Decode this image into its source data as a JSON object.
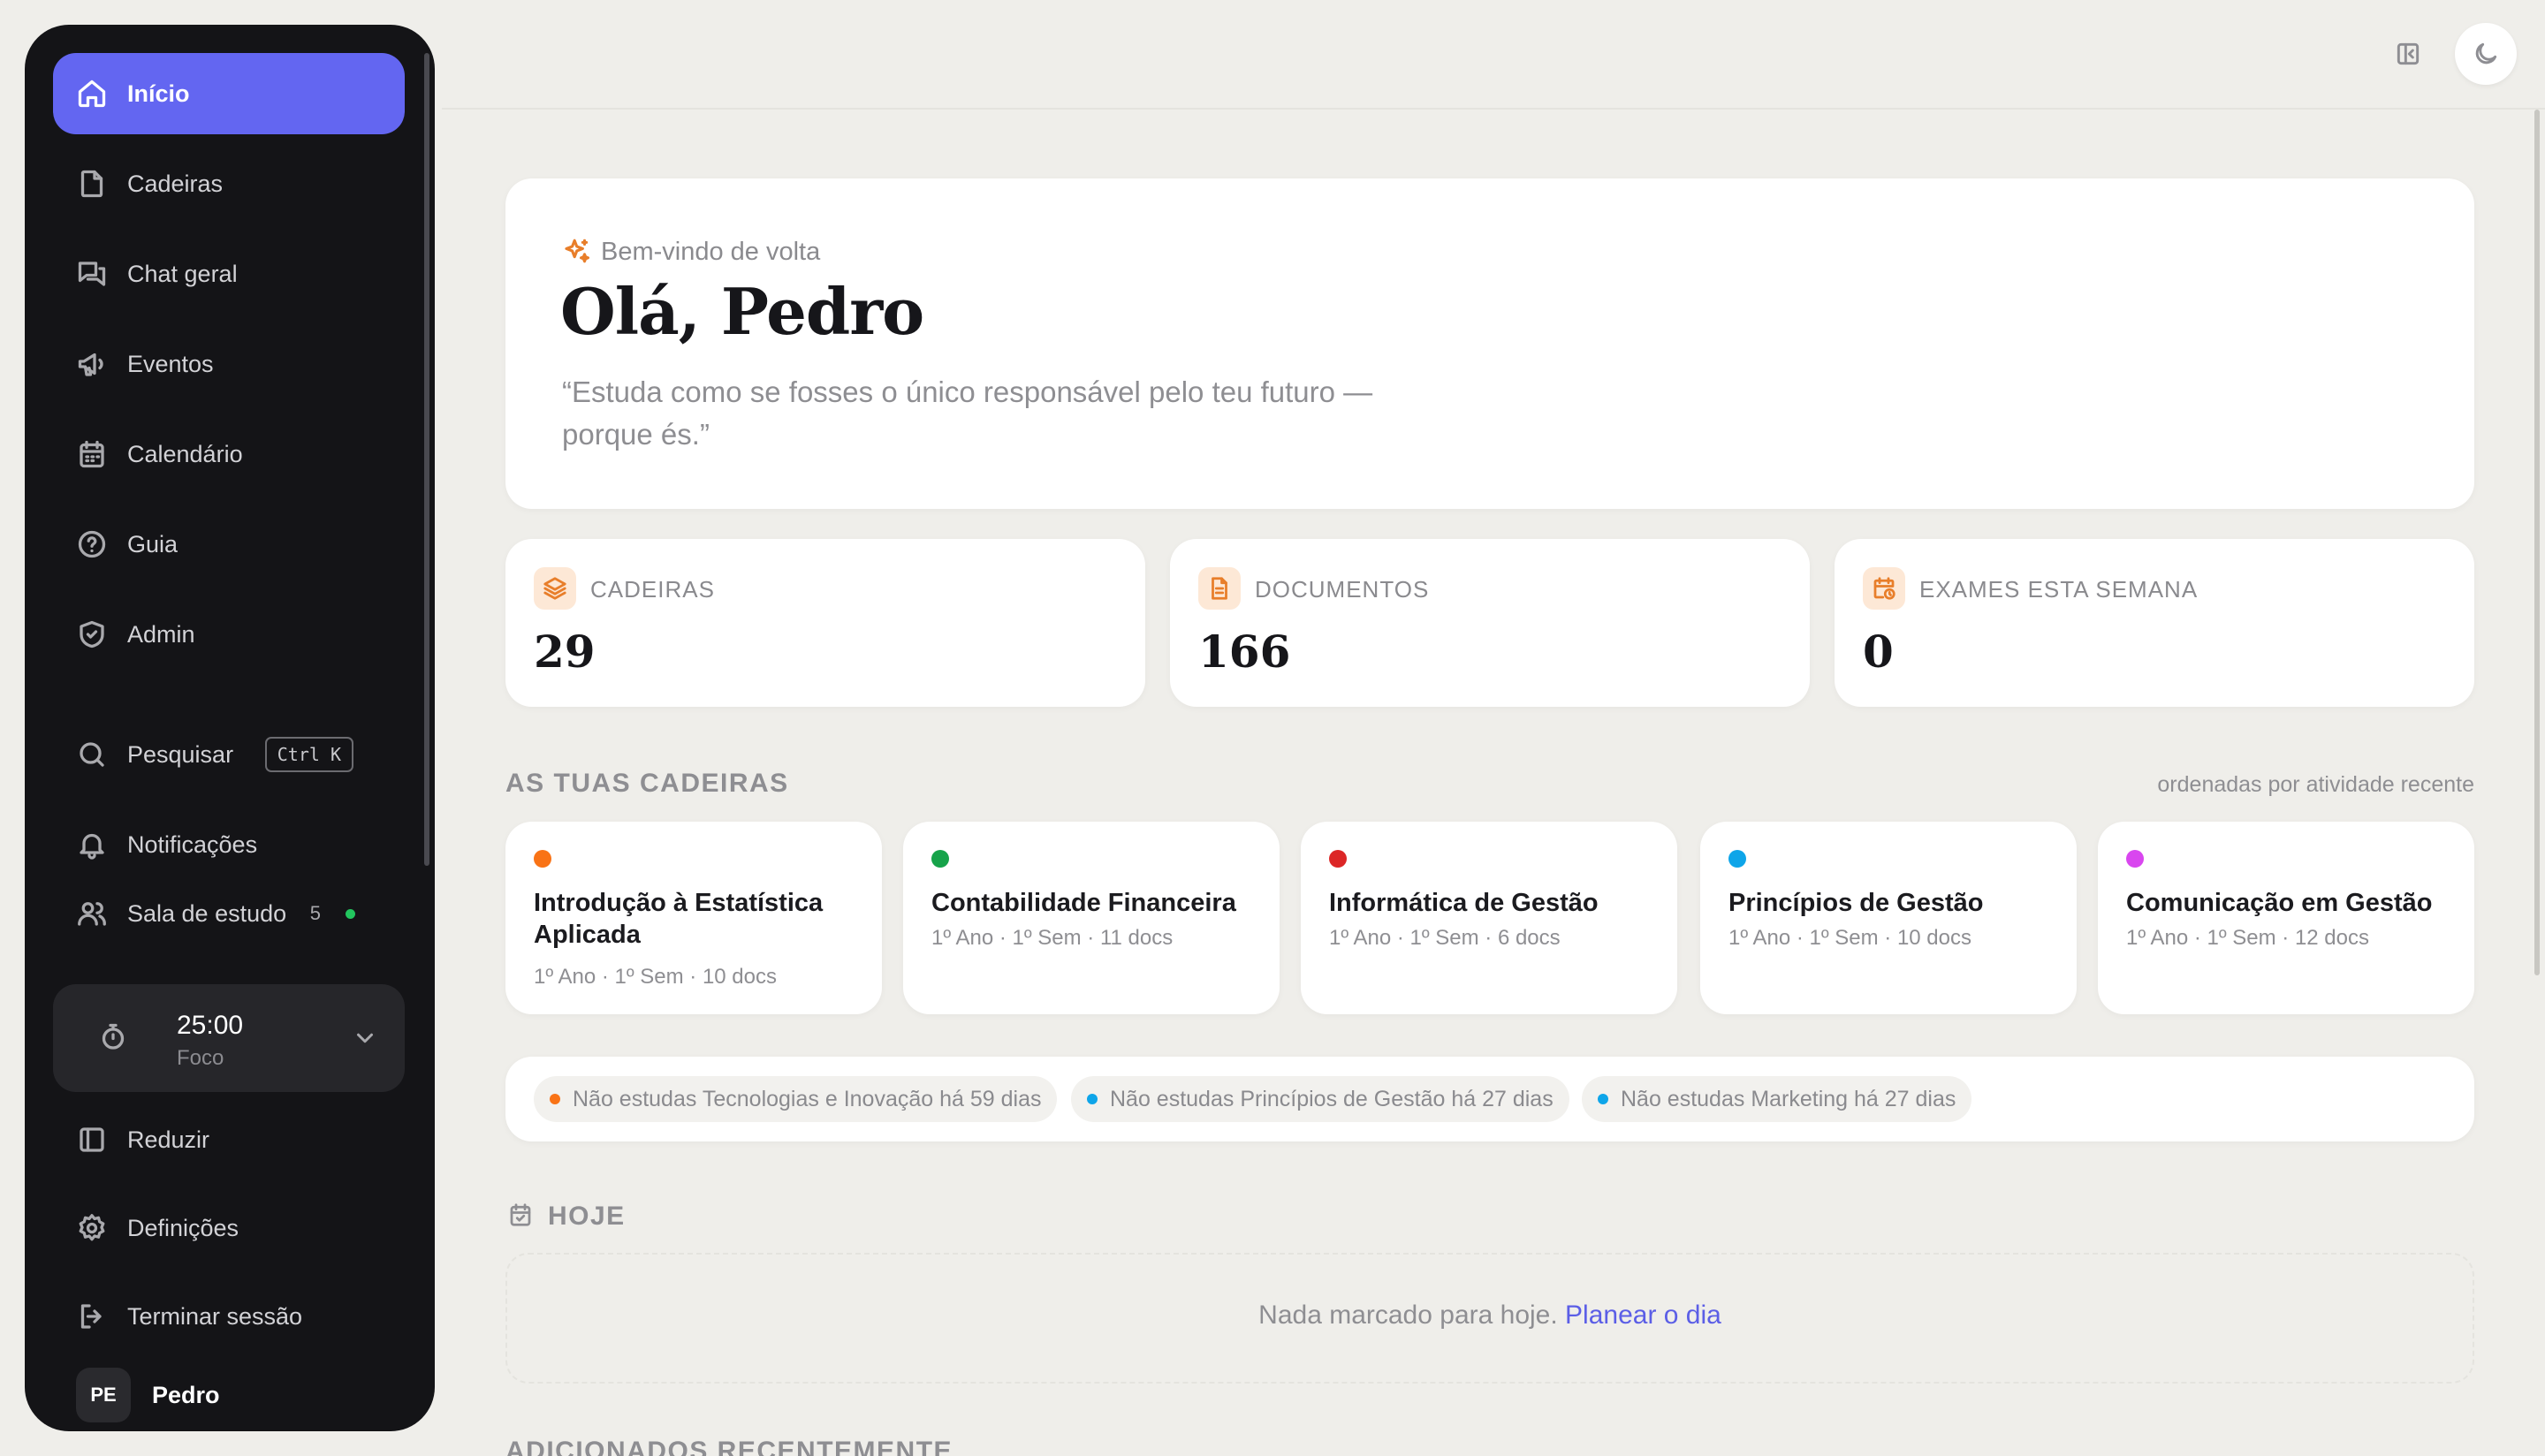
{
  "sidebar": {
    "items": [
      {
        "label": "Início",
        "icon": "home-icon"
      },
      {
        "label": "Cadeiras",
        "icon": "file-icon"
      },
      {
        "label": "Chat geral",
        "icon": "chat-icon"
      },
      {
        "label": "Eventos",
        "icon": "megaphone-icon"
      },
      {
        "label": "Calendário",
        "icon": "calendar-icon"
      },
      {
        "label": "Guia",
        "icon": "help-icon"
      },
      {
        "label": "Admin",
        "icon": "shield-icon"
      }
    ],
    "search": {
      "label": "Pesquisar",
      "shortcut": "Ctrl K"
    },
    "notifications": "Notificações",
    "study_room": {
      "label": "Sala de estudo",
      "count": "5"
    },
    "timer": {
      "time": "25:00",
      "mode": "Foco"
    },
    "collapse": "Reduzir",
    "settings": "Definições",
    "logout": "Terminar sessão",
    "user": {
      "initials": "PE",
      "name": "Pedro"
    }
  },
  "welcome": {
    "eyebrow": "Bem-vindo de volta",
    "greeting": "Olá, Pedro",
    "quote_line1": "“Estuda como se fosses o único responsável pelo teu futuro —",
    "quote_line2": "porque és.”"
  },
  "stats": [
    {
      "label": "CADEIRAS",
      "value": "29",
      "icon": "layers-icon"
    },
    {
      "label": "DOCUMENTOS",
      "value": "166",
      "icon": "document-icon"
    },
    {
      "label": "EXAMES ESTA SEMANA",
      "value": "0",
      "icon": "calendar-clock-icon"
    }
  ],
  "courses_section": {
    "title": "AS TUAS CADEIRAS",
    "note": "ordenadas por atividade recente"
  },
  "courses": [
    {
      "name": "Introdução à Estatística Aplicada",
      "meta": "1º Ano · 1º Sem · 10 docs",
      "color": "#f97316"
    },
    {
      "name": "Contabilidade Financeira",
      "meta": "1º Ano · 1º Sem · 11 docs",
      "color": "#16a34a"
    },
    {
      "name": "Informática de Gestão",
      "meta": "1º Ano · 1º Sem · 6 docs",
      "color": "#dc2626"
    },
    {
      "name": "Princípios de Gestão",
      "meta": "1º Ano · 1º Sem · 10 docs",
      "color": "#0ea5e9"
    },
    {
      "name": "Comunicação em Gestão",
      "meta": "1º Ano · 1º Sem · 12 docs",
      "color": "#d946ef"
    }
  ],
  "alerts": [
    {
      "text": "Não estudas Tecnologias e Inovação há 59 dias",
      "color": "#f97316"
    },
    {
      "text": "Não estudas Princípios de Gestão há 27 dias",
      "color": "#0ea5e9"
    },
    {
      "text": "Não estudas Marketing há 27 dias",
      "color": "#0ea5e9"
    }
  ],
  "today": {
    "title": "HOJE",
    "empty": "Nada marcado para hoje.",
    "action": "Planear o dia"
  },
  "recent": {
    "title": "ADICIONADOS RECENTEMENTE"
  }
}
